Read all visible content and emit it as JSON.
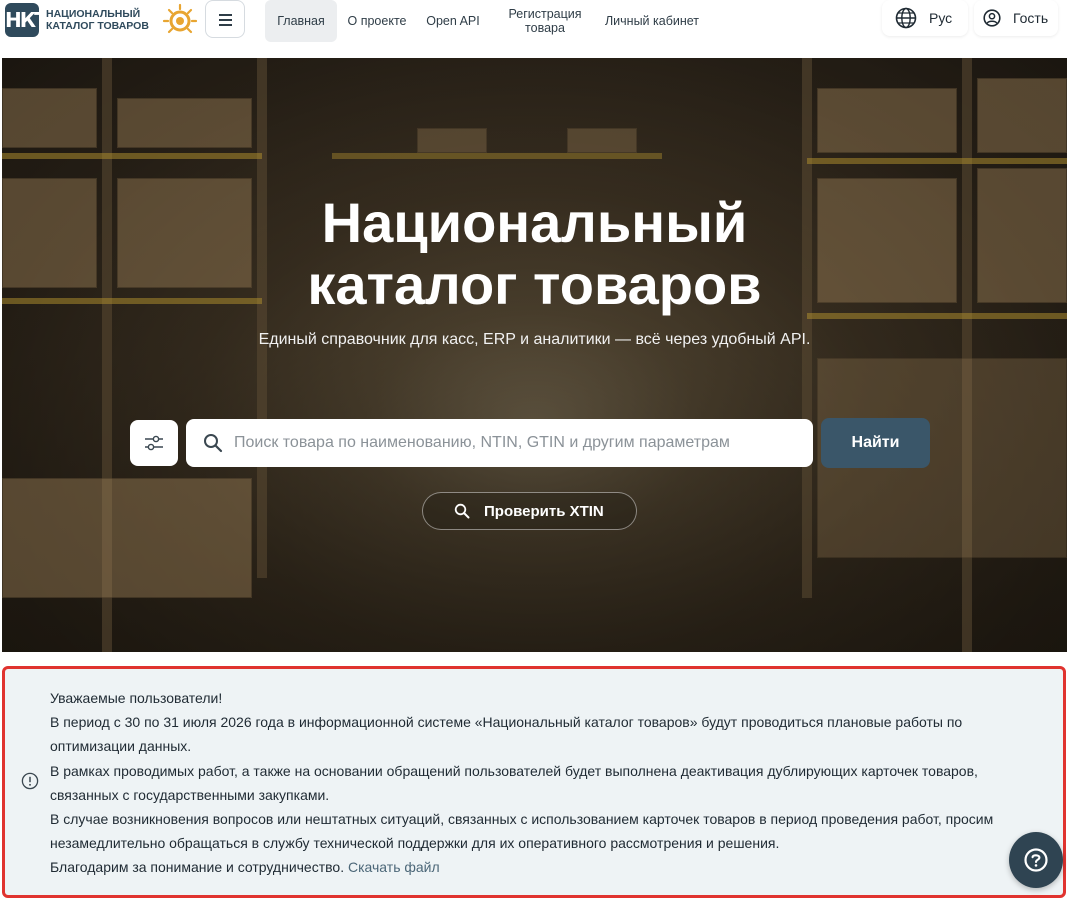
{
  "header": {
    "logo_line1": "НАЦИОНАЛЬНЫЙ",
    "logo_line2": "КАТАЛОГ ТОВАРОВ",
    "logo_mark": "НКТ",
    "nav": [
      {
        "label": "Главная",
        "active": true
      },
      {
        "label": "О проекте",
        "active": false
      },
      {
        "label": "Open API",
        "active": false
      },
      {
        "label": "Регистрация товара",
        "active": false
      },
      {
        "label": "Личный кабинет",
        "active": false
      }
    ],
    "language_label": "Рус",
    "user_label": "Гость"
  },
  "hero": {
    "title_line1": "Национальный",
    "title_line2": "каталог товаров",
    "subtitle": "Единый справочник для касс, ERP и аналитики — всё через удобный API.",
    "search_placeholder": "Поиск товара по наименованию, NTIN, GTIN и другим параметрам",
    "search_button": "Найти",
    "xtin_button": "Проверить XTIN"
  },
  "notice": {
    "lines": [
      "Уважаемые пользователи!",
      "В период с 30 по 31 июля 2026 года в информационной системе «Национальный каталог товаров» будут проводиться плановые работы по оптимизации данных.",
      "В рамках проводимых работ, а также на основании обращений пользователей будет выполнена деактивация дублирующих карточек товаров, связанных с государственными закупками.",
      "В случае возникновения вопросов или нештатных ситуаций, связанных с использованием карточек товаров в период проведения работ, просим незамедлительно обращаться в службу технической поддержки для их оперативного рассмотрения и решения."
    ],
    "closing": "Благодарим за понимание и сотрудничество.",
    "download_link": "Скачать файл"
  },
  "colors": {
    "brand": "#2f4a5c",
    "button": "#3a5669",
    "notice_border": "#e0332f",
    "notice_bg": "#eef3f5",
    "logo_sun": "#e8a531"
  },
  "icons": [
    "menu-icon",
    "globe-icon",
    "user-icon",
    "filter-icon",
    "search-icon",
    "info-icon",
    "question-icon"
  ]
}
